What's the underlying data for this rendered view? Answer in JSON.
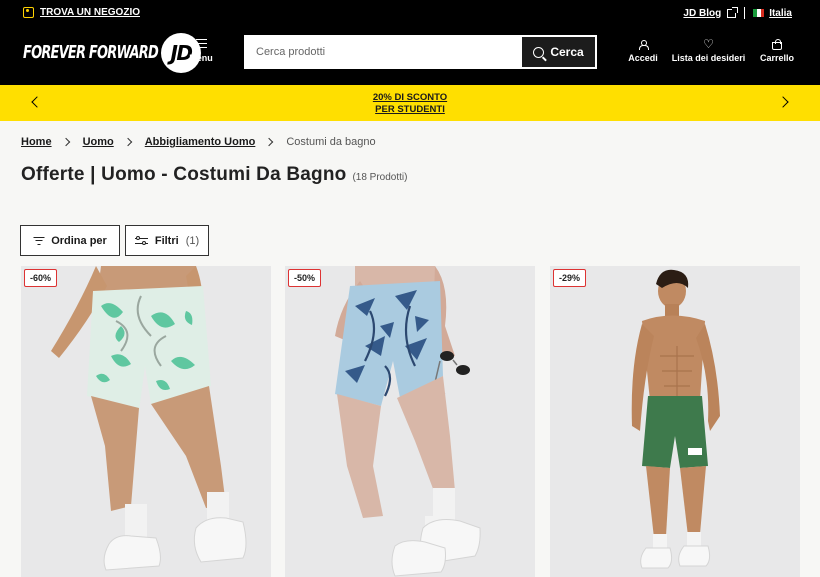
{
  "topbar": {
    "store_label": "TROVA UN NEGOZIO",
    "blog_label": "JD Blog",
    "language_label": "Italia"
  },
  "header": {
    "logo_tagline": "FOREVER FORWARD",
    "logo_mark": "JD",
    "menu_label": "Menu",
    "search_placeholder": "Cerca prodotti",
    "search_button": "Cerca",
    "login_label": "Accedi",
    "wishlist_label": "Lista dei desideri",
    "cart_label": "Carrello"
  },
  "promo": {
    "line1": "20% DI SCONTO",
    "line2": "PER STUDENTI"
  },
  "breadcrumb": {
    "items": [
      "Home",
      "Uomo",
      "Abbigliamento Uomo"
    ],
    "current": "Costumi da bagno"
  },
  "page": {
    "title": "Offerte | Uomo - Costumi Da Bagno",
    "count": "(18 Prodotti)"
  },
  "controls": {
    "sort_label": "Ordina per",
    "filter_label": "Filtri",
    "filter_count": "(1)"
  },
  "products": [
    {
      "discount": "-60%",
      "icon": "green-floral-swim-shorts"
    },
    {
      "discount": "-50%",
      "icon": "blue-palm-swim-shorts"
    },
    {
      "discount": "-29%",
      "icon": "green-nike-swim-shorts"
    }
  ],
  "colors": {
    "brand_black": "#000000",
    "promo_yellow": "#ffdf00",
    "discount_border": "#dd3333"
  }
}
